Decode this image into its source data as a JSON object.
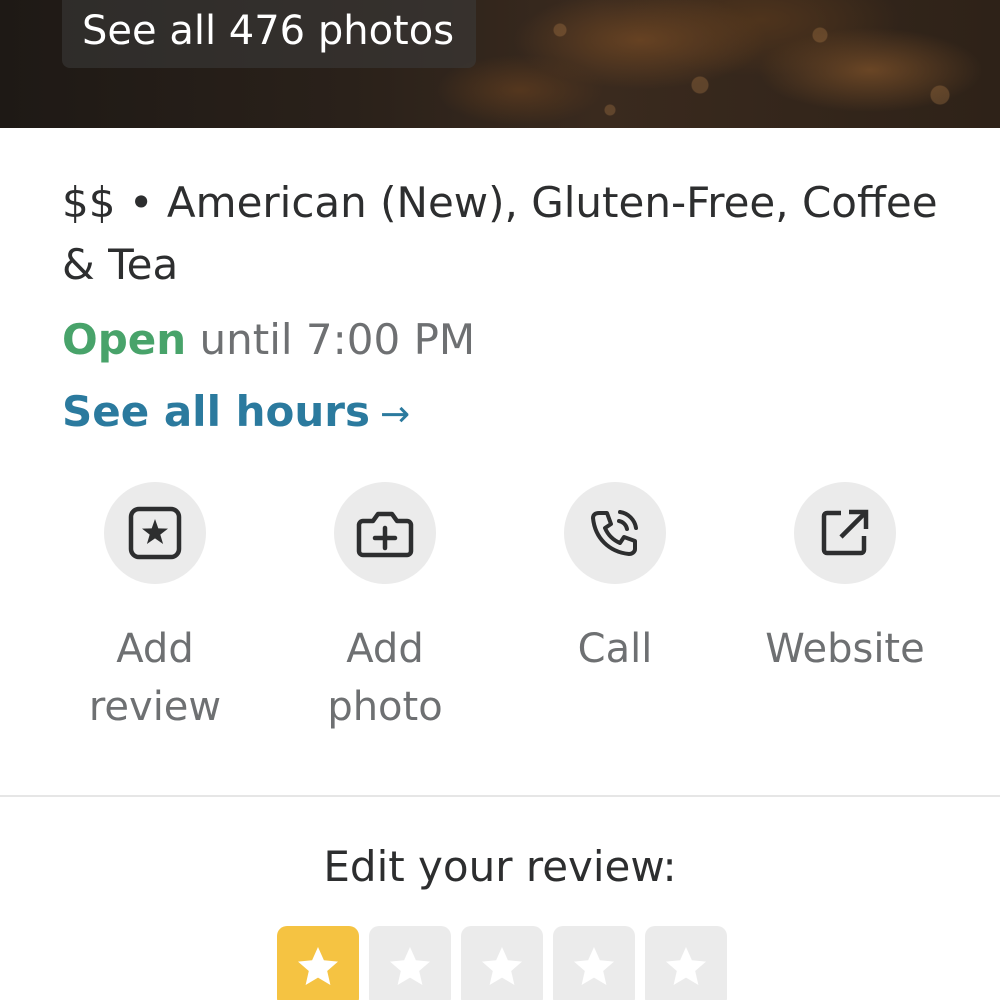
{
  "photos": {
    "see_all_label": "See all 476 photos"
  },
  "business": {
    "category_line": "$$ • American (New), Gluten-Free, Coffee & Tea",
    "open_status": "Open",
    "hours_text": "until 7:00 PM",
    "see_all_hours_label": "See all hours",
    "see_all_hours_arrow": "→"
  },
  "actions": [
    {
      "label": "Add review",
      "icon": "star-box-icon"
    },
    {
      "label": "Add photo",
      "icon": "camera-plus-icon"
    },
    {
      "label": "Call",
      "icon": "phone-icon"
    },
    {
      "label": "Website",
      "icon": "external-link-icon"
    }
  ],
  "review": {
    "title": "Edit your review:",
    "rating": 1,
    "max_rating": 5
  },
  "colors": {
    "open_green": "#48a36a",
    "link_blue": "#2b7a9e",
    "star_yellow": "#f5c342",
    "icon_circle": "#ebebeb"
  }
}
